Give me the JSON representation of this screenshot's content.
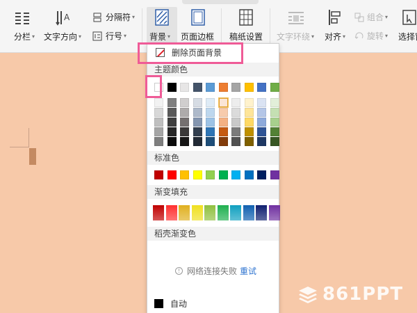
{
  "toolbar": {
    "columns": "分栏",
    "text_direction": "文字方向",
    "separator": "分隔符",
    "line_number": "行号",
    "background": "背景",
    "page_border": "页面边框",
    "paper_settings": "稿纸设置",
    "text_wrap": "文字环绕",
    "align": "对齐",
    "group": "组合",
    "rotate": "旋转",
    "select": "选择窗"
  },
  "panel": {
    "remove_background": "删除页面背景",
    "theme_colors_title": "主题颜色",
    "standard_colors_title": "标准色",
    "gradient_fill_title": "渐变填充",
    "shell_gradient_title": "稻壳渐变色",
    "network_message": "网络连接失败",
    "retry": "重试",
    "auto": "自动"
  },
  "theme_top_row": [
    "#ffffff",
    "#000000",
    "#e7e6e6",
    "#44546a",
    "#5b9bd5",
    "#ed7d31",
    "#a5a5a5",
    "#ffc000",
    "#4472c4",
    "#70ad47"
  ],
  "theme_shades": [
    [
      "#f2f2f2",
      "#7f7f7f",
      "#d0cece",
      "#d6dce4",
      "#deebf6",
      "#fbe5d5",
      "#ededed",
      "#fff2cc",
      "#dae3f3",
      "#e2efd9"
    ],
    [
      "#d8d8d8",
      "#595959",
      "#aeabab",
      "#adb9ca",
      "#bdd7ee",
      "#f7cbac",
      "#dbdbdb",
      "#fee599",
      "#b4c6e7",
      "#c5e0b3"
    ],
    [
      "#bfbfbf",
      "#3f3f3f",
      "#757070",
      "#8496b0",
      "#9dc3e6",
      "#f4b183",
      "#c9c9c9",
      "#ffd965",
      "#8eaadb",
      "#a8d08d"
    ],
    [
      "#a5a5a5",
      "#262626",
      "#3a3838",
      "#323f4f",
      "#2e75b5",
      "#c55a11",
      "#7b7b7b",
      "#bf9000",
      "#2f5496",
      "#538135"
    ],
    [
      "#7f7f7f",
      "#0c0c0c",
      "#171616",
      "#222a35",
      "#1e4e79",
      "#833c0b",
      "#525252",
      "#7f6000",
      "#1f3864",
      "#375623"
    ]
  ],
  "standard_colors": [
    "#c00000",
    "#ff0000",
    "#ffc000",
    "#ffff00",
    "#92d050",
    "#00b050",
    "#00b0f0",
    "#0070c0",
    "#002060",
    "#7030a0"
  ],
  "gradient_colors": [
    "#c00000",
    "#ff3030",
    "#e0b020",
    "#f0e020",
    "#90c040",
    "#20b050",
    "#10a0c0",
    "#1060b0",
    "#102070",
    "#7030a0"
  ],
  "highlight_color": "#ef5b97",
  "watermark": "861PPT"
}
